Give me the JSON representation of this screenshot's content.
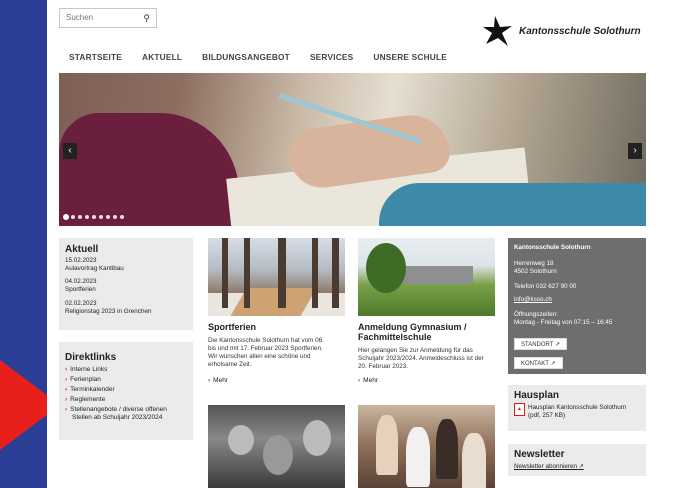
{
  "search": {
    "placeholder": "Suchen",
    "icon": "search-icon"
  },
  "brand": {
    "name": "Kantonsschule Solothurn"
  },
  "nav": [
    "STARTSEITE",
    "AKTUELL",
    "BILDUNGSANGEBOT",
    "SERVICES",
    "UNSERE SCHULE"
  ],
  "hero": {
    "prev": "‹",
    "next": "›",
    "dot_count": 9,
    "active_dot": 0
  },
  "aktuell": {
    "title": "Aktuell",
    "items": [
      {
        "date": "15.02.2023",
        "text": "Aulavortrag Kantibau"
      },
      {
        "date": "04.02.2023",
        "text": "Sportferien"
      },
      {
        "date": "02.02.2023",
        "text": "Religionstag 2023 in Grenchen"
      }
    ]
  },
  "direktlinks": {
    "title": "Direktlinks",
    "items": [
      "Interne Links",
      "Ferienplan",
      "Terminkalender",
      "Reglemente",
      "Stellenangebote / diverse offenen",
      "Stellen ab Schuljahr 2023/2024"
    ]
  },
  "cards": [
    {
      "title": "Sportferien",
      "title_line2": "",
      "text": [
        "Die Kantonsschule Solothurn hat vom 06.",
        "bis und mit 17. Februar 2023 Sportferien.",
        "Wir wünschen allen eine schöne und",
        "erholsame Zeit."
      ],
      "more": "Mehr"
    },
    {
      "title": "Anmeldung Gymnasium /",
      "title_line2": "Fachmittelschule",
      "text": [
        "Hier gelangen Sie zur Anmeldung für das",
        "Schuljahr 2023/2024. Anmeldeschluss ist der",
        "20. Februar 2023."
      ],
      "more": "Mehr"
    }
  ],
  "contact": {
    "title": "Kantonsschule Solothurn",
    "street": "Herrenweg 18",
    "city": "4502 Solothurn",
    "phone": "Telefon 032 627 90 00",
    "email": "info@ksso.ch",
    "hours_label": "Öffnungszeiten:",
    "hours": "Montag - Freitag von 07:15 – 16:45",
    "btn_standort": "STANDORT",
    "btn_kontakt": "KONTAKT",
    "ext_icon": "↗"
  },
  "hausplan": {
    "title": "Hausplan",
    "link": "Hausplan Kantonsschule Solothurn",
    "meta": "(pdf, 257 KB)"
  },
  "newsletter": {
    "title": "Newsletter",
    "link": "Newsletter abonnieren"
  },
  "colors": {
    "brand_blue": "#2b3e95",
    "accent_red": "#d21f1f",
    "box_gray": "#ebebeb",
    "contact_gray": "#6d6e70"
  }
}
